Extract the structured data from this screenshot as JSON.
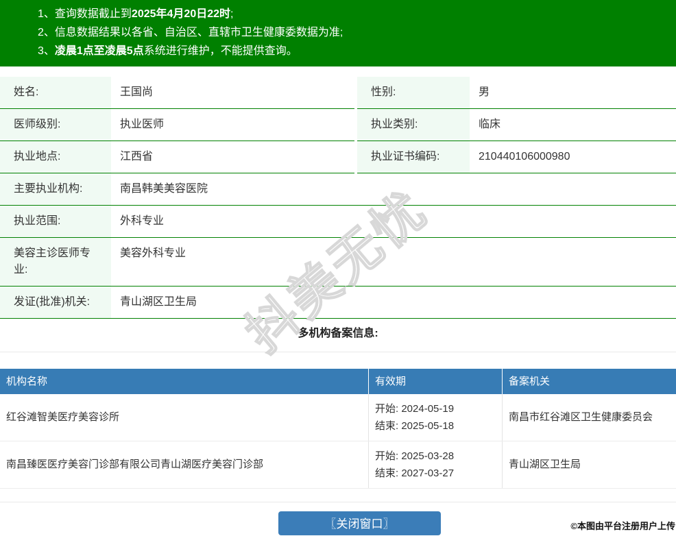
{
  "notice": {
    "bg_color": "#008000",
    "lines": [
      {
        "num": "1、",
        "pre": "查询数据截止到",
        "bold": "2025年4月20日22时",
        "post": ";"
      },
      {
        "num": "2、",
        "pre": "信息数据结果以各省、自治区、直辖市卫生健康委数据为准;",
        "bold": "",
        "post": ""
      },
      {
        "num": "3、",
        "pre": "",
        "bold": "凌晨1点至凌晨5点",
        "post": "系统进行维护，不能提供查询。"
      }
    ]
  },
  "info": {
    "label_bg_color": "#f0faf3",
    "border_color": "#008000",
    "paired_rows": [
      {
        "label1": "姓名:",
        "value1": "王国尚",
        "label2": "性别:",
        "value2": "男"
      },
      {
        "label1": "医师级别:",
        "value1": "执业医师",
        "label2": "执业类别:",
        "value2": "临床"
      },
      {
        "label1": "执业地点:",
        "value1": "江西省",
        "label2": "执业证书编码:",
        "value2": "210440106000980"
      }
    ],
    "full_rows": [
      {
        "label": "主要执业机构:",
        "value": "南昌韩美美容医院"
      },
      {
        "label": "执业范围:",
        "value": "外科专业"
      },
      {
        "label": "美容主诊医师专业:",
        "value": "美容外科专业"
      },
      {
        "label": "发证(批准)机关:",
        "value": "青山湖区卫生局"
      }
    ]
  },
  "filing": {
    "section_title": "多机构备案信息:",
    "header_bg_color": "#377cb5",
    "headers": [
      "机构名称",
      "有效期",
      "备案机关"
    ],
    "rows": [
      {
        "org": "红谷滩智美医疗美容诊所",
        "start": "开始: 2024-05-19",
        "end": "结束: 2025-05-18",
        "authority": "南昌市红谷滩区卫生健康委员会"
      },
      {
        "org": "南昌臻医医疗美容门诊部有限公司青山湖医疗美容门诊部",
        "start": "开始: 2025-03-28",
        "end": "结束: 2027-03-27",
        "authority": "青山湖区卫生局"
      }
    ]
  },
  "footer": {
    "close_button_label": "〖关闭窗口〗",
    "button_color": "#3b7db8",
    "caption": "©本图由平台注册用户上传"
  },
  "watermark": {
    "text": "抖美无忧"
  }
}
